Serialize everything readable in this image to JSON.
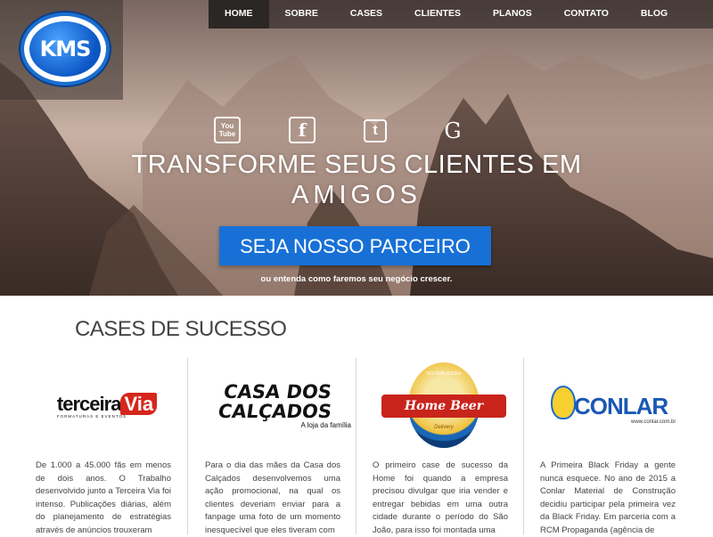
{
  "nav": {
    "items": [
      {
        "label": "HOME",
        "active": true
      },
      {
        "label": "SOBRE"
      },
      {
        "label": "CASES"
      },
      {
        "label": "CLIENTES"
      },
      {
        "label": "PLANOS"
      },
      {
        "label": "CONTATO"
      },
      {
        "label": "BLOG"
      }
    ]
  },
  "logo": {
    "text": "KMS",
    "small": "Serviços Administrativos"
  },
  "social": {
    "youtube_text": "You\nTube",
    "facebook_text": "f",
    "twitter_text": "t",
    "google_text": "G"
  },
  "hero": {
    "headline_line1": "TRANSFORME SEUS CLIENTES EM",
    "headline_line2": "AMIGOS",
    "cta_label": "SEJA NOSSO PARCEIRO",
    "subtext": "ou entenda como faremos seu negócio crescer."
  },
  "cases": {
    "title": "CASES DE SUCESSO",
    "items": [
      {
        "logo_main": "terceira",
        "logo_accent": "Via",
        "logo_sub": "FORMATURAS E EVENTOS",
        "text": "De 1.000 a 45.000 fãs em menos de dois anos. O Trabalho desenvolvido junto a Terceira Via foi intenso. Publicações diárias, além do planejamento de estratégias através de anúncios trouxeram"
      },
      {
        "logo_main": "CASA DOS CALÇADOS",
        "logo_sub": "A loja da família",
        "text": "Para o dia das mães da Casa dos Calçados desenvolvemos uma ação promocional, na qual os clientes deveriam enviar para a fanpage uma foto de um momento inesquecível que eles tiveram com"
      },
      {
        "logo_main": "Home Beer",
        "logo_top": "DISTRIBUIDORA",
        "logo_sub": "Delivery",
        "text": "O primeiro case de sucesso da Home foi quando a empresa precisou divulgar que iria vender e entregar bebidas em uma outra cidade durante o período do São João, para isso foi montada uma"
      },
      {
        "logo_main": "CONLAR",
        "logo_sub": "www.conlar.com.br",
        "text": "A Primeira Black Friday a gente nunca esquece. No ano de 2015 a Conlar Material de Construção decidiu participar pela primeira vez da Black Friday. Em parceria com a RCM Propaganda (agência de"
      }
    ]
  }
}
